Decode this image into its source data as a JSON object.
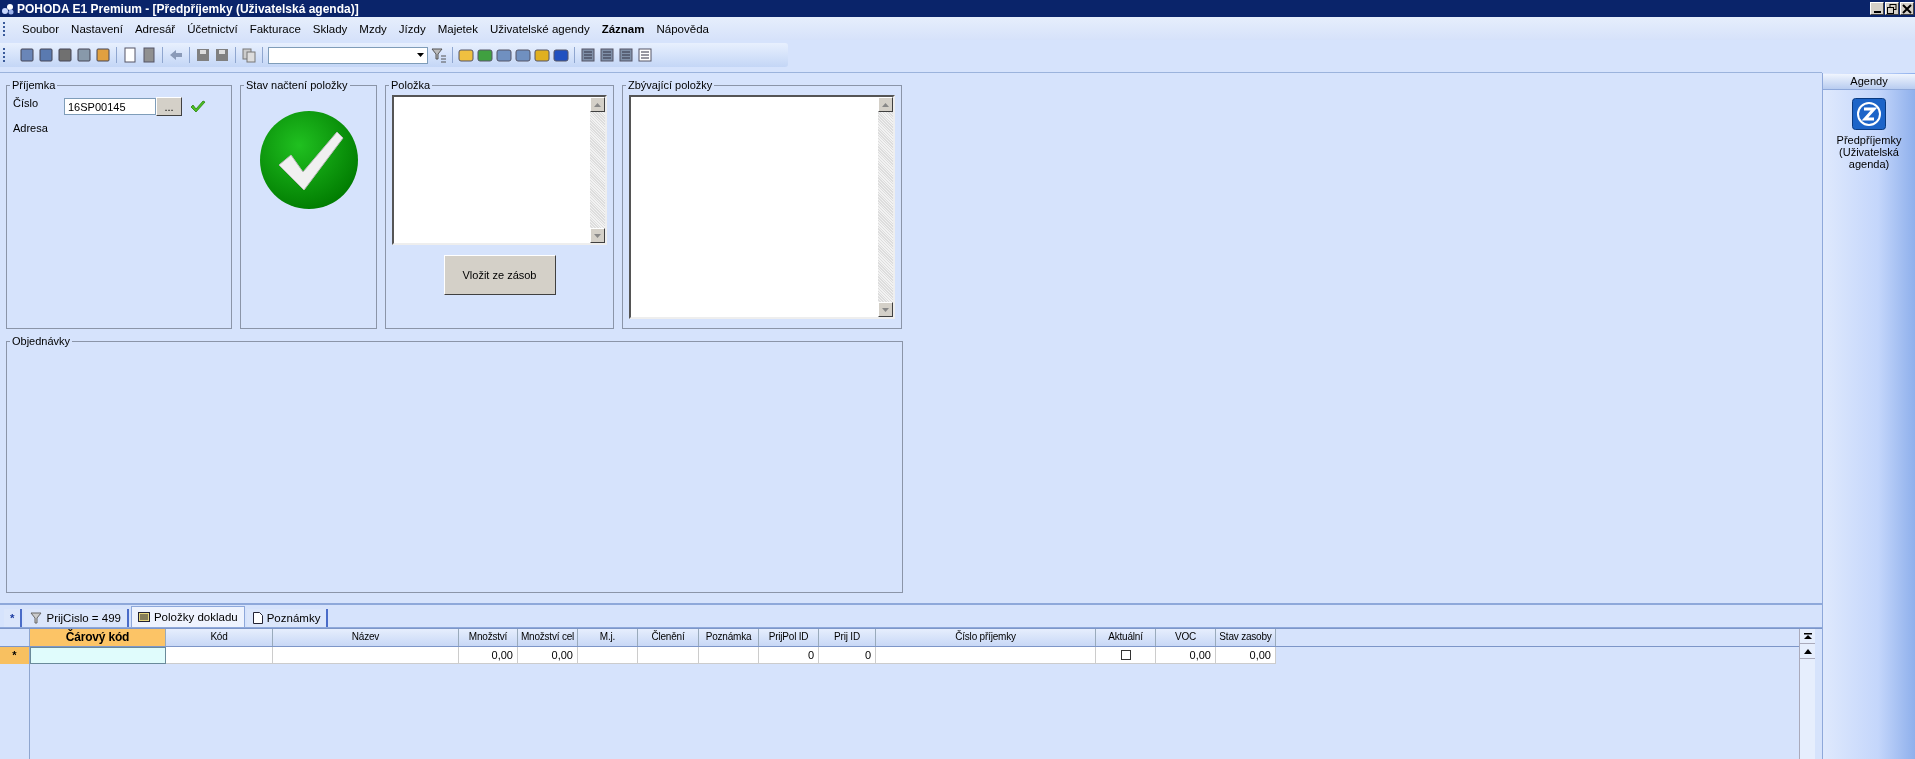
{
  "window": {
    "title": "POHODA E1 Premium - [Předpříjemky (Uživatelská agenda)]"
  },
  "menu": [
    {
      "label": "Soubor",
      "bold": false
    },
    {
      "label": "Nastavení",
      "bold": false
    },
    {
      "label": "Adresář",
      "bold": false
    },
    {
      "label": "Účetnictví",
      "bold": false
    },
    {
      "label": "Fakturace",
      "bold": false
    },
    {
      "label": "Sklady",
      "bold": false
    },
    {
      "label": "Mzdy",
      "bold": false
    },
    {
      "label": "Jízdy",
      "bold": false
    },
    {
      "label": "Majetek",
      "bold": false
    },
    {
      "label": "Uživatelské agendy",
      "bold": false
    },
    {
      "label": "Záznam",
      "bold": true
    },
    {
      "label": "Nápověda",
      "bold": false
    }
  ],
  "form": {
    "receipt": {
      "legend": "Příjemka",
      "number_label": "Číslo",
      "number_value": "16SP00145",
      "browse_button": "...",
      "address_label": "Adresa"
    },
    "status": {
      "legend": "Stav načtení položky",
      "loaded": true
    },
    "item": {
      "legend": "Položka",
      "insert_button": "Vložit ze zásob"
    },
    "remaining": {
      "legend": "Zbývající položky"
    },
    "orders": {
      "legend": "Objednávky"
    }
  },
  "tabs": [
    {
      "kind": "new",
      "label": "*",
      "selected": false
    },
    {
      "kind": "filter",
      "label": "PrijCislo = 499",
      "selected": false
    },
    {
      "kind": "items",
      "label": "Položky dokladu",
      "selected": true
    },
    {
      "kind": "notes",
      "label": "Poznámky",
      "selected": false
    }
  ],
  "grid": {
    "columns": [
      {
        "label": "Čárový kód",
        "selected": true
      },
      {
        "label": "Kód",
        "selected": false
      },
      {
        "label": "Název",
        "selected": false
      },
      {
        "label": "Množství",
        "selected": false
      },
      {
        "label": "Množství cel",
        "selected": false
      },
      {
        "label": "M.j.",
        "selected": false
      },
      {
        "label": "Členění",
        "selected": false
      },
      {
        "label": "Poznámka",
        "selected": false
      },
      {
        "label": "PrijPol ID",
        "selected": false
      },
      {
        "label": "Prij ID",
        "selected": false
      },
      {
        "label": "Číslo příjemky",
        "selected": false
      },
      {
        "label": "Aktuální",
        "selected": false
      },
      {
        "label": "VOC",
        "selected": false
      },
      {
        "label": "Stav zasoby",
        "selected": false
      }
    ],
    "rows": [
      {
        "marker": "*",
        "cells": [
          {
            "kind": "edit"
          },
          {
            "kind": "empty"
          },
          {
            "kind": "empty"
          },
          {
            "kind": "number",
            "value": "0,00"
          },
          {
            "kind": "number",
            "value": "0,00"
          },
          {
            "kind": "empty"
          },
          {
            "kind": "empty"
          },
          {
            "kind": "empty"
          },
          {
            "kind": "number",
            "value": "0"
          },
          {
            "kind": "number",
            "value": "0"
          },
          {
            "kind": "empty"
          },
          {
            "kind": "checkbox",
            "checked": false
          },
          {
            "kind": "number",
            "value": "0,00"
          },
          {
            "kind": "number",
            "value": "0,00"
          }
        ]
      }
    ]
  },
  "sidebar": {
    "header": "Agendy",
    "items": [
      {
        "label": "Předpříjemky (Uživatelská agenda)"
      }
    ]
  }
}
